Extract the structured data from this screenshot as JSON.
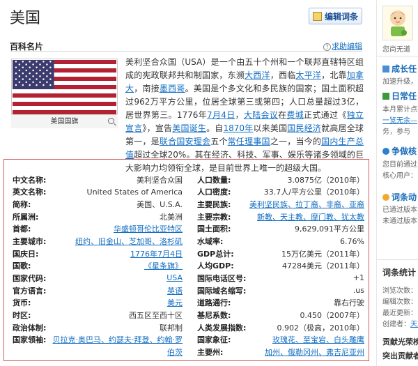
{
  "title": "美国",
  "edit_button": "编辑词条",
  "card": {
    "heading": "百科名片",
    "help_link": "求助编辑",
    "flag_caption": "美国国旗"
  },
  "intro": [
    {
      "t": "美利坚合众国（USA）是一个由五十个州和一个联邦直辖特区组成的宪政联邦共和制国家，东濒"
    },
    {
      "t": "大西洋",
      "link": true
    },
    {
      "t": "，西临"
    },
    {
      "t": "太平洋",
      "link": true
    },
    {
      "t": "，北靠"
    },
    {
      "t": "加拿大",
      "link": true
    },
    {
      "t": "，南接"
    },
    {
      "t": "墨西哥",
      "link": true
    },
    {
      "t": "。美国是个多文化和多民族的国家；国土面积超过962万平方公里，位居全球第三或第四；人口总量超过3亿，居世界第三。1776年"
    },
    {
      "t": "7月4日",
      "link": true
    },
    {
      "t": "，"
    },
    {
      "t": "大陆会议",
      "link": true
    },
    {
      "t": "在"
    },
    {
      "t": "费城",
      "link": true
    },
    {
      "t": "正式通过《"
    },
    {
      "t": "独立宣言",
      "link": true
    },
    {
      "t": "》，宣告"
    },
    {
      "t": "美国诞生",
      "link": true
    },
    {
      "t": "。自"
    },
    {
      "t": "1870年",
      "link": true
    },
    {
      "t": "以来美国"
    },
    {
      "t": "国民经济",
      "link": true
    },
    {
      "t": "就高居全球第一，是"
    },
    {
      "t": "联合国安理会",
      "link": true
    },
    {
      "t": "五个"
    },
    {
      "t": "常任理事国",
      "link": true
    },
    {
      "t": "之一，当今的"
    },
    {
      "t": "国内生产总值",
      "link": true
    },
    {
      "t": "超过全球20%。其在经济、科技、军事、娱乐等诸多领域的巨大影响力均领衔全球，是目前世界上唯一的超级大国。"
    }
  ],
  "info_left": [
    {
      "k": "中文名称:",
      "v": "美利坚合众国",
      "link": false
    },
    {
      "k": "英文名称:",
      "v": "United States of America",
      "link": false
    },
    {
      "k": "简称:",
      "v": "美国、U.S.A.",
      "link": false
    },
    {
      "k": "所属洲:",
      "v": "北美洲",
      "link": false
    },
    {
      "k": "首都:",
      "v": "华盛顿哥伦比亚特区",
      "link": true
    },
    {
      "k": "主要城市:",
      "v": "纽约、旧金山、芝加哥、洛杉矶",
      "link": true
    },
    {
      "k": "国庆日:",
      "v": "1776年7月4日",
      "link": true
    },
    {
      "k": "国歌:",
      "v": "《星条旗》",
      "link": true
    },
    {
      "k": "国家代码:",
      "v": "USA",
      "link": true
    },
    {
      "k": "官方语言:",
      "v": "英语",
      "link": true
    },
    {
      "k": "货币:",
      "v": "美元",
      "link": true
    },
    {
      "k": "时区:",
      "v": "西五区至西十区",
      "link": false
    },
    {
      "k": "政治体制:",
      "v": "联邦制",
      "link": false
    },
    {
      "k": "国家领袖:",
      "v": "贝拉克·奥巴马、约瑟夫·拜登、约翰·罗",
      "link": true
    },
    {
      "k": "",
      "v": "伯茨",
      "link": true
    }
  ],
  "info_right": [
    {
      "k": "人口数量:",
      "v": "3.0875亿（2010年）",
      "link": false
    },
    {
      "k": "人口密度:",
      "v": "33.7人/平方公里（2010年）",
      "link": false
    },
    {
      "k": "主要民族:",
      "v": "美利坚民族、拉丁裔、非裔、亚裔",
      "link": true
    },
    {
      "k": "主要宗教:",
      "v": "新教、天主教、摩门教、犹太教",
      "link": true
    },
    {
      "k": "国土面积:",
      "v": "9,629,091平方公里",
      "link": false
    },
    {
      "k": "水域率:",
      "v": "6.76%",
      "link": false
    },
    {
      "k": "GDP总计:",
      "v": "15万亿美元（2011年）",
      "link": false
    },
    {
      "k": "人均GDP:",
      "v": "47284美元（2011年）",
      "link": false
    },
    {
      "k": "国际电话区号:",
      "v": "+1",
      "link": false
    },
    {
      "k": "国际域名缩写:",
      "v": ".us",
      "link": false
    },
    {
      "k": "道路通行:",
      "v": "靠右行驶",
      "link": false
    },
    {
      "k": "基尼系数:",
      "v": "0.450（2007年）",
      "link": false
    },
    {
      "k": "人类发展指数:",
      "v": "0.902（极高，2010年）",
      "link": false
    },
    {
      "k": "国家象征:",
      "v": "玫瑰花、至宝宕、白头雕鹰",
      "link": true
    },
    {
      "k": "主要州:",
      "v": "加州、俄勒冈州、弗吉尼亚州",
      "link": true
    }
  ],
  "sidebar": {
    "user_text": "您尚无道",
    "growth_head": "成长任",
    "growth_text": "加速升级，",
    "daily_head": "日常任",
    "daily_text1": "本月累计点亮",
    "daily_text2": "一览无余—",
    "daily_text3": "务，参与",
    "compete_head": "争做核",
    "compete_text1": "您目前通过",
    "compete_text2": "核心用户：",
    "dynamic_head": "词条动",
    "dynamic_text1": "已通过版本",
    "dynamic_text2": "未通过版本",
    "stats_head": "词条统计",
    "stats_1": "浏览次数：",
    "stats_2": "编辑次数：",
    "stats_3": "最近更新：",
    "stats_4": "创建者：",
    "stats_4_link": "天才",
    "contrib_head": "贡献光荣榜",
    "contrib_sub": "突出贡献者"
  }
}
